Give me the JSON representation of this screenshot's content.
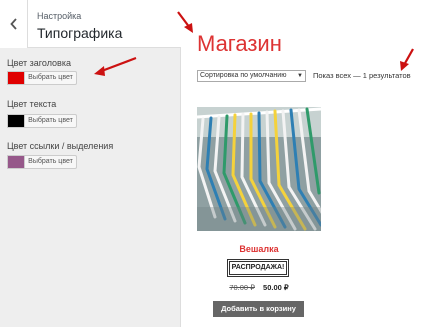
{
  "customizer": {
    "section_label": "Настройка",
    "section_title": "Типографика",
    "controls": [
      {
        "label": "Цвет заголовка",
        "color": "#e00000",
        "button": "Выбрать цвет"
      },
      {
        "label": "Цвет текста",
        "color": "#000000",
        "button": "Выбрать цвет"
      },
      {
        "label": "Цвет ссылки / выделения",
        "color": "#96588a",
        "button": "Выбрать цвет"
      }
    ]
  },
  "shop": {
    "title": "Магазин",
    "title_color": "#dd3333",
    "sort_selected": "Сортировка по умолчанию",
    "result_count": "Показ всех — 1 результатов",
    "product": {
      "name": "Вешалка",
      "badge": "РАСПРОДАЖА!",
      "price_old": "70.00 ₽",
      "price_new": "50.00 ₽",
      "cart_button": "Добавить в корзину"
    }
  },
  "annotation_color": "#cc1111"
}
